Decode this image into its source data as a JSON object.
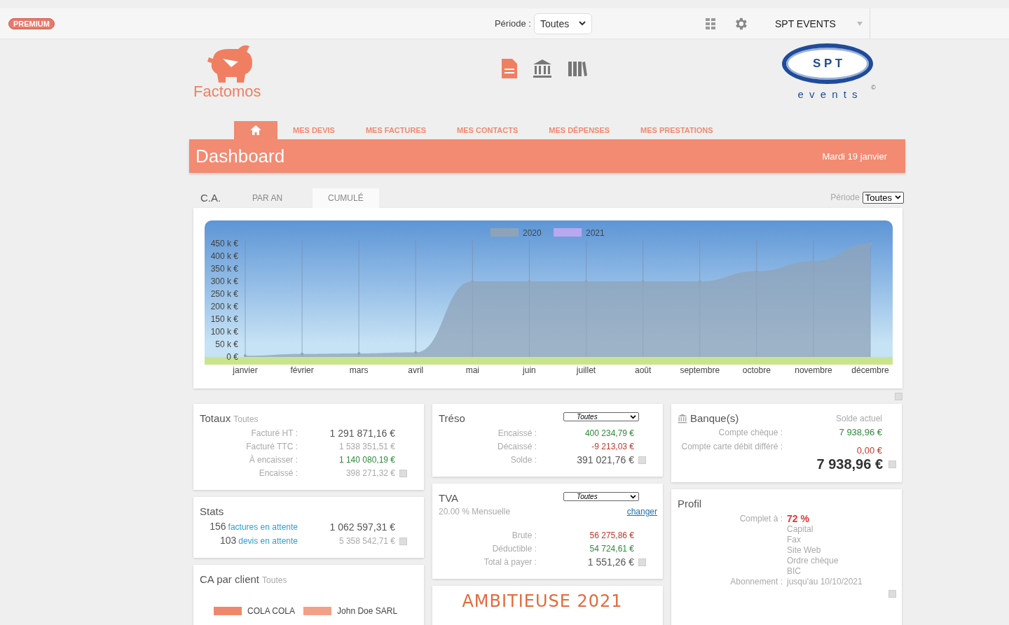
{
  "top_bar": {
    "badge": "PREMIUM",
    "period_label": "Période :",
    "period_value": "Toutes",
    "company": "SPT EVENTS"
  },
  "brand": {
    "name": "Factomos"
  },
  "client_logo": {
    "letters": "S P T",
    "mark": "©",
    "subtitle": "e v e n t s"
  },
  "nav": [
    {
      "kind": "home",
      "selected": true
    },
    {
      "kind": "link",
      "label": "MES DEVIS",
      "selected": false
    },
    {
      "kind": "link",
      "label": "MES FACTURES",
      "selected": false
    },
    {
      "kind": "link",
      "label": "MES CONTACTS",
      "selected": false
    },
    {
      "kind": "link",
      "label": "MES DÉPENSES",
      "selected": false
    },
    {
      "kind": "link",
      "label": "MES PRESTATIONS",
      "selected": false
    }
  ],
  "header": {
    "title": "Dashboard",
    "date": "Mardi 19 janvier"
  },
  "ca": {
    "title": "C.A.",
    "tabs": [
      {
        "label": "PAR AN",
        "selected": false
      },
      {
        "label": "CUMULÉ",
        "selected": true
      }
    ],
    "period_label": "Période",
    "period_value": "Toutes",
    "chart_data": {
      "type": "area",
      "grid": true,
      "categories": [
        "janvier",
        "février",
        "mars",
        "avril",
        "mai",
        "juin",
        "juillet",
        "août",
        "septembre",
        "octobre",
        "novembre",
        "décembre"
      ],
      "series": [
        {
          "name": "2020",
          "color": "#8fa3b8",
          "values": [
            5,
            12,
            14,
            18,
            300,
            300,
            300,
            300,
            300,
            340,
            380,
            450
          ]
        },
        {
          "name": "2021",
          "color": "#b9a8f0",
          "values": [
            null,
            null,
            null,
            null,
            null,
            null,
            null,
            null,
            null,
            null,
            null,
            null
          ]
        }
      ],
      "ylim": [
        0,
        450
      ],
      "yticks": [
        {
          "value": 0,
          "label": "0 €"
        },
        {
          "value": 50,
          "label": "50 k €"
        },
        {
          "value": 100,
          "label": "100 k €"
        },
        {
          "value": 150,
          "label": "150 k €"
        },
        {
          "value": 200,
          "label": "200 k €"
        },
        {
          "value": 250,
          "label": "250 k €"
        },
        {
          "value": 300,
          "label": "300 k €"
        },
        {
          "value": 350,
          "label": "350 k €"
        },
        {
          "value": 400,
          "label": "400 k €"
        },
        {
          "value": 450,
          "label": "450 k €"
        }
      ]
    }
  },
  "totaux": {
    "title": "Totaux",
    "filter": "Toutes",
    "rows": [
      {
        "label": "Facturé HT :",
        "value": "1 291 871,16 €",
        "color": "#555555",
        "emphasis": true
      },
      {
        "label": "Facturé TTC :",
        "value": "1 538 351,51 €",
        "color": "#aaaaaa",
        "emphasis": false
      },
      {
        "label": "À encaisser :",
        "value": "1 140 080,19 €",
        "color": "#2e8b3a",
        "emphasis": false
      },
      {
        "label": "Encaissé :",
        "value": "398 271,32 €",
        "color": "#aaaaaa",
        "emphasis": false
      }
    ]
  },
  "stats": {
    "title": "Stats",
    "rows": [
      {
        "count": "156",
        "link": "factures en attente",
        "value": "1 062 597,31 €",
        "color": "#555555",
        "emphasis": true
      },
      {
        "count": "103",
        "link": "devis en attente",
        "value": "5 358 542,71 €",
        "color": "#aaaaaa",
        "emphasis": false
      }
    ]
  },
  "ca_client": {
    "title": "CA par client",
    "filter": "Toutes",
    "legend": [
      {
        "name": "COLA COLA",
        "color": "#f0876a"
      },
      {
        "name": "John Doe SARL",
        "color": "#f4a088"
      }
    ]
  },
  "treso": {
    "title": "Tréso",
    "select": "Toutes",
    "rows": [
      {
        "label": "Encaissé :",
        "value": "400 234,79 €",
        "color": "#2e8b3a",
        "emphasis": false
      },
      {
        "label": "Décaissé :",
        "value": "-9 213,03 €",
        "color": "#c0392b",
        "emphasis": false
      },
      {
        "label": "Solde :",
        "value": "391 021,76 €",
        "color": "#555555",
        "emphasis": true
      }
    ]
  },
  "tva": {
    "title": "TVA",
    "select": "Toutes",
    "rate": "20.00 % Mensuelle",
    "link": "changer",
    "rows": [
      {
        "label": "Brute :",
        "value": "56 275,86 €",
        "color": "#c0392b",
        "emphasis": false
      },
      {
        "label": "Déductible :",
        "value": "54 724,61 €",
        "color": "#2e8b3a",
        "emphasis": false
      },
      {
        "label": "Total à payer :",
        "value": "1 551,26 €",
        "color": "#555555",
        "emphasis": true
      }
    ]
  },
  "goal": {
    "title": "AMBITIEUSE 2021"
  },
  "banques": {
    "title": "Banque(s)",
    "column": "Solde actuel",
    "rows": [
      {
        "label": "Compte chèque :",
        "value": "7 938,96 €",
        "color": "#2e8b3a"
      },
      {
        "label": "Compte carte débit différé :",
        "value": "0,00 €",
        "color": "#c0392b"
      }
    ],
    "total": "7 938,96 €"
  },
  "profil": {
    "title": "Profil",
    "complete_label": "Complet à :",
    "complete_value": "72 %",
    "missing": [
      "Capital",
      "Fax",
      "Site Web",
      "Ordre chèque",
      "BIC"
    ],
    "subscription_label": "Abonnement :",
    "subscription_value": "jusqu'au 10/10/2021"
  }
}
